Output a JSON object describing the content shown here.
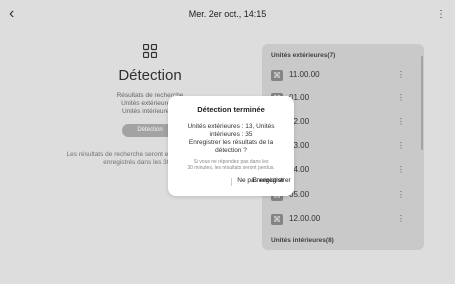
{
  "header": {
    "back_icon": "chevron-left-icon",
    "title": "Mer. 2er oct., 14:15",
    "more_icon": "vertical-dots-icon"
  },
  "left_panel": {
    "app_icon": "grid-icon",
    "title": "Détection",
    "results_label": "Résultats de recherche",
    "outdoor_units": "Unités extérieures 7",
    "indoor_units": "Unités intérieures 8",
    "scan_button": "Détection",
    "note": "Les résultats de recherche seront effacés s'ils ne sont pas enregistrés dans les 30 minutes."
  },
  "right_panel": {
    "outdoor_header": "Unités extérieures(7)",
    "units": [
      {
        "label": "11.00.00",
        "icon": "unit-icon"
      },
      {
        "label": "01.00",
        "icon": "unit-icon"
      },
      {
        "label": "02.00",
        "icon": "unit-icon"
      },
      {
        "label": "03.00",
        "icon": "unit-icon"
      },
      {
        "label": "04.00",
        "icon": "unit-icon"
      },
      {
        "label": "05.00",
        "icon": "unit-icon"
      },
      {
        "label": "12.00.00",
        "icon": "unit-icon"
      }
    ],
    "indoor_header": "Unités intérieures(8)"
  },
  "dialog": {
    "title": "Détection terminée",
    "body_line1": "Unités extérieures : 13, Unités",
    "body_line2": "intérieures : 35",
    "body_line3": "Enregistrer les résultats de la",
    "body_line4": "détection ?",
    "small_line1": "Si vous ne répondez pas dans les",
    "small_line2": "30 minutes, les résultats seront perdus.",
    "cancel_label": "Ne pas enregistrer",
    "confirm_label": "Enregistrer"
  }
}
